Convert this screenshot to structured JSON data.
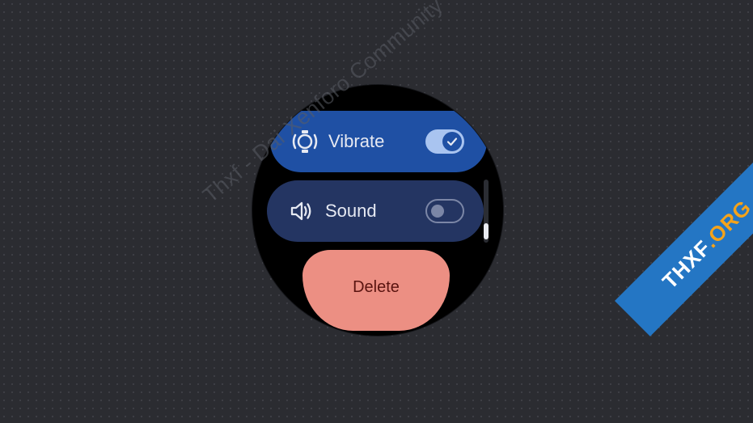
{
  "watch": {
    "vibrate": {
      "label": "Vibrate",
      "enabled": true,
      "icon": "vibrate-watch-icon"
    },
    "sound": {
      "label": "Sound",
      "enabled": false,
      "icon": "speaker-icon"
    },
    "delete": {
      "label": "Delete"
    },
    "scroll_position": 0.75
  },
  "watermark": {
    "text": "Thxf - Dai Xenforo Community"
  },
  "corner_badge": {
    "main": "THXF",
    "accent": ".ORG"
  },
  "colors": {
    "background": "#2b2c31",
    "vibrate_chip": "#1f50a4",
    "sound_chip": "#243562",
    "delete_button": "#ec8f83",
    "badge": "#2476c4",
    "badge_accent": "#f5a31a"
  }
}
